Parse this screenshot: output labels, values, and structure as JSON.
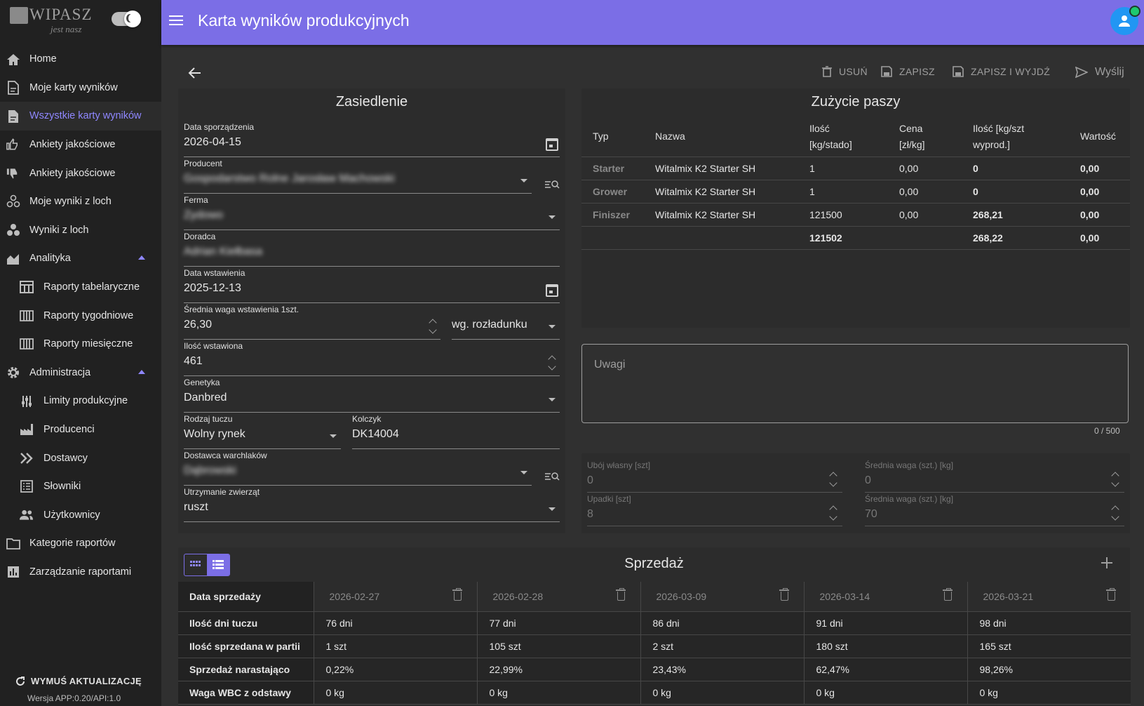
{
  "app": {
    "logo_text": "WIPASZ",
    "logo_sub": "jest nasz"
  },
  "header": {
    "title": "Karta wyników produkcyjnych"
  },
  "sidebar": {
    "items": [
      {
        "label": "Home",
        "icon": "home-icon"
      },
      {
        "label": "Moje karty wyników",
        "icon": "document-icon"
      },
      {
        "label": "Wszystkie karty wyników",
        "icon": "documents-icon"
      },
      {
        "label": "Ankiety jakościowe",
        "icon": "thumbs-icon"
      },
      {
        "label": "Ankiety jakościowe",
        "icon": "thumb-down-icon"
      },
      {
        "label": "Moje wyniki z loch",
        "icon": "bubbles-icon"
      },
      {
        "label": "Wyniki z loch",
        "icon": "bubbles-filled-icon"
      },
      {
        "label": "Analityka",
        "icon": "chart-area-icon"
      },
      {
        "label": "Raporty tabelaryczne",
        "icon": "table-icon"
      },
      {
        "label": "Raporty tygodniowe",
        "icon": "columns-icon"
      },
      {
        "label": "Raporty miesięczne",
        "icon": "columns-icon"
      },
      {
        "label": "Administracja",
        "icon": "gear-icon"
      },
      {
        "label": "Limity produkcyjne",
        "icon": "tune-icon"
      },
      {
        "label": "Producenci",
        "icon": "factory-icon"
      },
      {
        "label": "Dostawcy",
        "icon": "double-chevron-icon"
      },
      {
        "label": "Słowniki",
        "icon": "list-icon"
      },
      {
        "label": "Użytkownicy",
        "icon": "users-icon"
      },
      {
        "label": "Kategorie raportów",
        "icon": "folder-icon"
      },
      {
        "label": "Zarządzanie raportami",
        "icon": "bar-chart-icon"
      }
    ],
    "active": "Wszystkie karty wyników",
    "accent": "#8f87ff",
    "force_update": "WYMUŚ AKTUALIZACJĘ",
    "version": "Wersja APP:0.20/API:1.0"
  },
  "toolbar": {
    "delete": "USUŃ",
    "save": "ZAPISZ",
    "save_exit": "ZAPISZ I WYJDŹ",
    "send": "Wyślij"
  },
  "settlement": {
    "title": "Zasiedlenie",
    "date_label": "Data sporządzenia",
    "date_value": "2026-04-15",
    "producer_label": "Producent",
    "producer_value": "Gospodarstwo Rolne Jarosław Machowski",
    "farm_label": "Ferma",
    "farm_value": "Zydowo",
    "advisor_label": "Doradca",
    "advisor_value": "Adrian Kiełbasa",
    "insert_date_label": "Data wstawienia",
    "insert_date_value": "2025-12-13",
    "avg_weight_label": "Średnia waga wstawienia 1szt.",
    "avg_weight_value": "26,30",
    "weight_mode_value": "wg. rozładunku",
    "qty_label": "Ilość wstawiona",
    "qty_value": "461",
    "genetics_label": "Genetyka",
    "genetics_value": "Danbred",
    "fattening_label": "Rodzaj tuczu",
    "fattening_value": "Wolny rynek",
    "tag_label": "Kolczyk",
    "tag_value": "DK14004",
    "supplier_label": "Dostawca warchlaków",
    "supplier_value": "Dąbrowski",
    "housing_label": "Utrzymanie zwierząt",
    "housing_value": "ruszt"
  },
  "feed": {
    "title": "Zużycie paszy",
    "headers": {
      "type": "Typ",
      "name": "Nazwa",
      "qty1": "Ilość",
      "qty2": "[kg/stado]",
      "price1": "Cena",
      "price2": "[zł/kg]",
      "per1": "Ilość [kg/szt",
      "per2": "wyprod.]",
      "value": "Wartość"
    },
    "rows": [
      {
        "type": "Starter",
        "name": "Witalmix K2 Starter SH",
        "qty": "1",
        "price": "0,00",
        "per": "0",
        "value": "0,00"
      },
      {
        "type": "Grower",
        "name": "Witalmix K2 Starter SH",
        "qty": "1",
        "price": "0,00",
        "per": "0",
        "value": "0,00"
      },
      {
        "type": "Finiszer",
        "name": "Witalmix K2 Starter SH",
        "qty": "121500",
        "price": "0,00",
        "per": "268,21",
        "value": "0,00"
      }
    ],
    "total": {
      "qty": "121502",
      "per": "268,22",
      "value": "0,00"
    }
  },
  "notes": {
    "placeholder": "Uwagi",
    "counter": "0 / 500"
  },
  "extra": {
    "own_slaughter_label": "Ubój własny [szt]",
    "own_slaughter_value": "0",
    "own_weight_label": "Średnia waga (szt.) [kg]",
    "own_weight_value": "0",
    "deaths_label": "Upadki [szt]",
    "deaths_value": "8",
    "deaths_weight_label": "Średnia waga (szt.) [kg]",
    "deaths_weight_value": "70"
  },
  "sales": {
    "title": "Sprzedaż",
    "row_labels": [
      "Data sprzedaży",
      "Ilość dni tuczu",
      "Ilość sprzedana w partii",
      "Sprzedaż narastająco",
      "Waga WBC z odstawy"
    ],
    "columns": [
      {
        "date": "2026-02-27",
        "days": "76 dni",
        "qty": "1 szt",
        "cum": "0,22%",
        "wbc": "0 kg"
      },
      {
        "date": "2026-02-28",
        "days": "77 dni",
        "qty": "105 szt",
        "cum": "22,99%",
        "wbc": "0 kg"
      },
      {
        "date": "2026-03-09",
        "days": "86 dni",
        "qty": "2 szt",
        "cum": "23,43%",
        "wbc": "0 kg"
      },
      {
        "date": "2026-03-14",
        "days": "91 dni",
        "qty": "180 szt",
        "cum": "62,47%",
        "wbc": "0 kg"
      },
      {
        "date": "2026-03-21",
        "days": "98 dni",
        "qty": "165 szt",
        "cum": "98,26%",
        "wbc": "0 kg"
      }
    ]
  }
}
